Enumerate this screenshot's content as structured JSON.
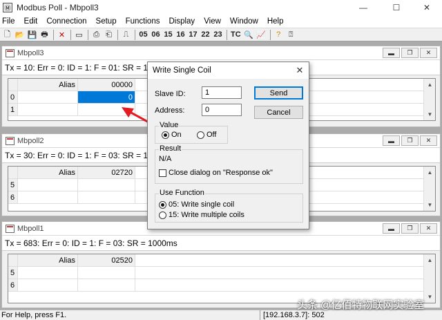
{
  "app": {
    "title": "Modbus Poll - Mbpoll3"
  },
  "window_controls": {
    "minimize": "—",
    "maximize": "☐",
    "close": "✕"
  },
  "menu": [
    "File",
    "Edit",
    "Connection",
    "Setup",
    "Functions",
    "Display",
    "View",
    "Window",
    "Help"
  ],
  "toolbar": {
    "function_buttons": [
      "05",
      "06",
      "15",
      "16",
      "17",
      "22",
      "23"
    ],
    "tc_label": "TC"
  },
  "windows": [
    {
      "title": "Mbpoll3",
      "status": "Tx = 10: Err = 0: ID = 1: F = 01: SR = 1000ms",
      "header": {
        "alias": "Alias",
        "value": "00000"
      },
      "rows": [
        {
          "idx": "0",
          "alias": "",
          "value": "0"
        },
        {
          "idx": "1",
          "alias": "",
          "value": ""
        }
      ]
    },
    {
      "title": "Mbpoll2",
      "status": "Tx = 30: Err = 0: ID = 1: F = 03: SR = 1000ms",
      "header": {
        "alias": "Alias",
        "value": "02720"
      },
      "rows": [
        {
          "idx": "5",
          "alias": "",
          "value": ""
        },
        {
          "idx": "6",
          "alias": "",
          "value": ""
        }
      ]
    },
    {
      "title": "Mbpoll1",
      "status": "Tx = 683: Err = 0: ID = 1: F = 03: SR = 1000ms",
      "header": {
        "alias": "Alias",
        "value": "02520"
      },
      "rows": [
        {
          "idx": "5",
          "alias": "",
          "value": ""
        },
        {
          "idx": "6",
          "alias": "",
          "value": ""
        }
      ]
    }
  ],
  "dialog": {
    "title": "Write Single Coil",
    "slave_id_label": "Slave ID:",
    "slave_id_value": "1",
    "address_label": "Address:",
    "address_value": "0",
    "send_label": "Send",
    "cancel_label": "Cancel",
    "value_group": "Value",
    "on_label": "On",
    "off_label": "Off",
    "value_selected": "On",
    "result_group": "Result",
    "result_text": "N/A",
    "close_dialog_label": "Close dialog on \"Response ok\"",
    "close_dialog_checked": false,
    "function_group": "Use Function",
    "func05_label": "05: Write single coil",
    "func15_label": "15: Write multiple coils",
    "function_selected": "05"
  },
  "statusbar": {
    "help": "For Help, press F1.",
    "connection": "[192.168.3.7]: 502"
  },
  "watermark": "头条 @亿佰特物联网实验室"
}
